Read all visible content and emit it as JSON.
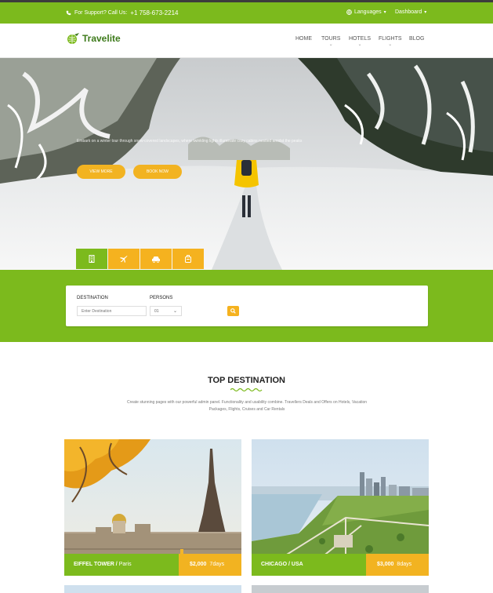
{
  "topbar": {
    "support_label": "For Support? Call Us:",
    "phone": "+1 758-673-2214",
    "languages_label": "Languages",
    "dashboard_label": "Dashboard"
  },
  "brand": {
    "name": "Travelite"
  },
  "nav": {
    "items": [
      {
        "label": "HOME"
      },
      {
        "label": "TOURS"
      },
      {
        "label": "HOTELS"
      },
      {
        "label": "FLIGHTS"
      },
      {
        "label": "BLOG"
      }
    ]
  },
  "hero": {
    "caption": "Embark on a winter tour through snow-covered landscapes, where twinkling lights illuminate cozy cabins nestled amidst the peaks",
    "btn_view": "VIEW MORE",
    "btn_book": "BOOK NOW"
  },
  "search_tabs": [
    {
      "icon": "hotel-icon"
    },
    {
      "icon": "plane-icon"
    },
    {
      "icon": "car-icon"
    },
    {
      "icon": "suitcase-icon"
    }
  ],
  "search": {
    "destination_label": "DESTINATION",
    "destination_placeholder": "Enter Destination",
    "persons_label": "PERSONS",
    "persons_value": "01"
  },
  "section": {
    "title": "TOP DESTINATION",
    "desc": "Create stunning pages with our powerful admin panel. Functionality and usability combine. Travellers Deals and Offers on Hotels, Vacation Packages, Flights, Cruises and Car Rentals"
  },
  "destinations": [
    {
      "name": "EIFFEL TOWER /",
      "sub": "Paris",
      "price": "$2,000",
      "days": "7days"
    },
    {
      "name": "CHICAGO / USA",
      "sub": "",
      "price": "$3,000",
      "days": "8days"
    }
  ],
  "colors": {
    "green": "#7cba1d",
    "yellow": "#f2b321",
    "dark": "#3c3c3c"
  }
}
